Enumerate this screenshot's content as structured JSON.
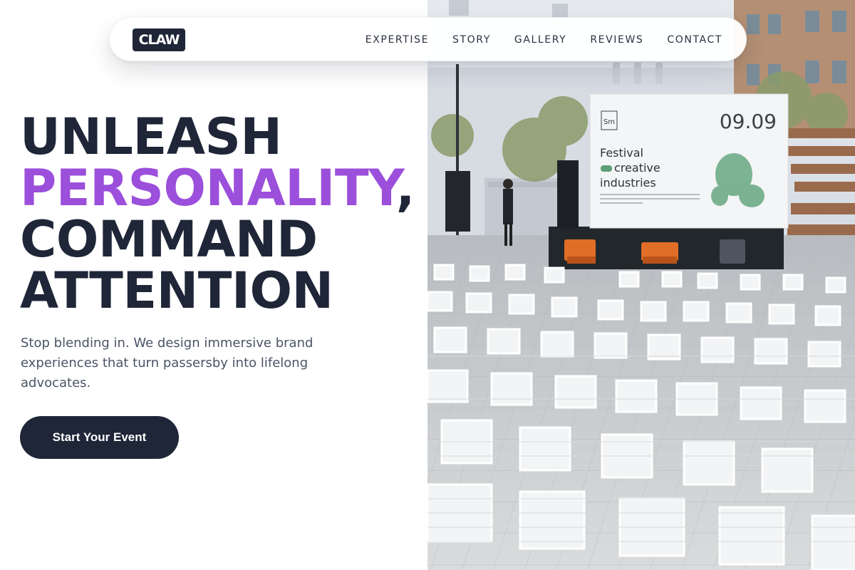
{
  "nav": {
    "logo": "CLAW",
    "links": [
      "EXPERTISE",
      "STORY",
      "GALLERY",
      "REVIEWS",
      "CONTACT"
    ]
  },
  "hero": {
    "headline": {
      "line1": "UNLEASH",
      "line2_accent": "PERSONALITY",
      "line2_punct": ",",
      "line3": "COMMAND",
      "line4": "ATTENTION"
    },
    "subtext": "Stop blending in. We design immersive brand experiences that turn passersby into lifelong advocates.",
    "cta_label": "Start Your Event"
  },
  "photo": {
    "screen": {
      "brand_mark": "Sm",
      "date": "09.09",
      "title_line1": "Festival",
      "title_line2": "creative",
      "title_line3": "industries"
    }
  },
  "colors": {
    "navy": "#1e2638",
    "accent_purple": "#9b4fdb",
    "body_text": "#4a5466"
  }
}
